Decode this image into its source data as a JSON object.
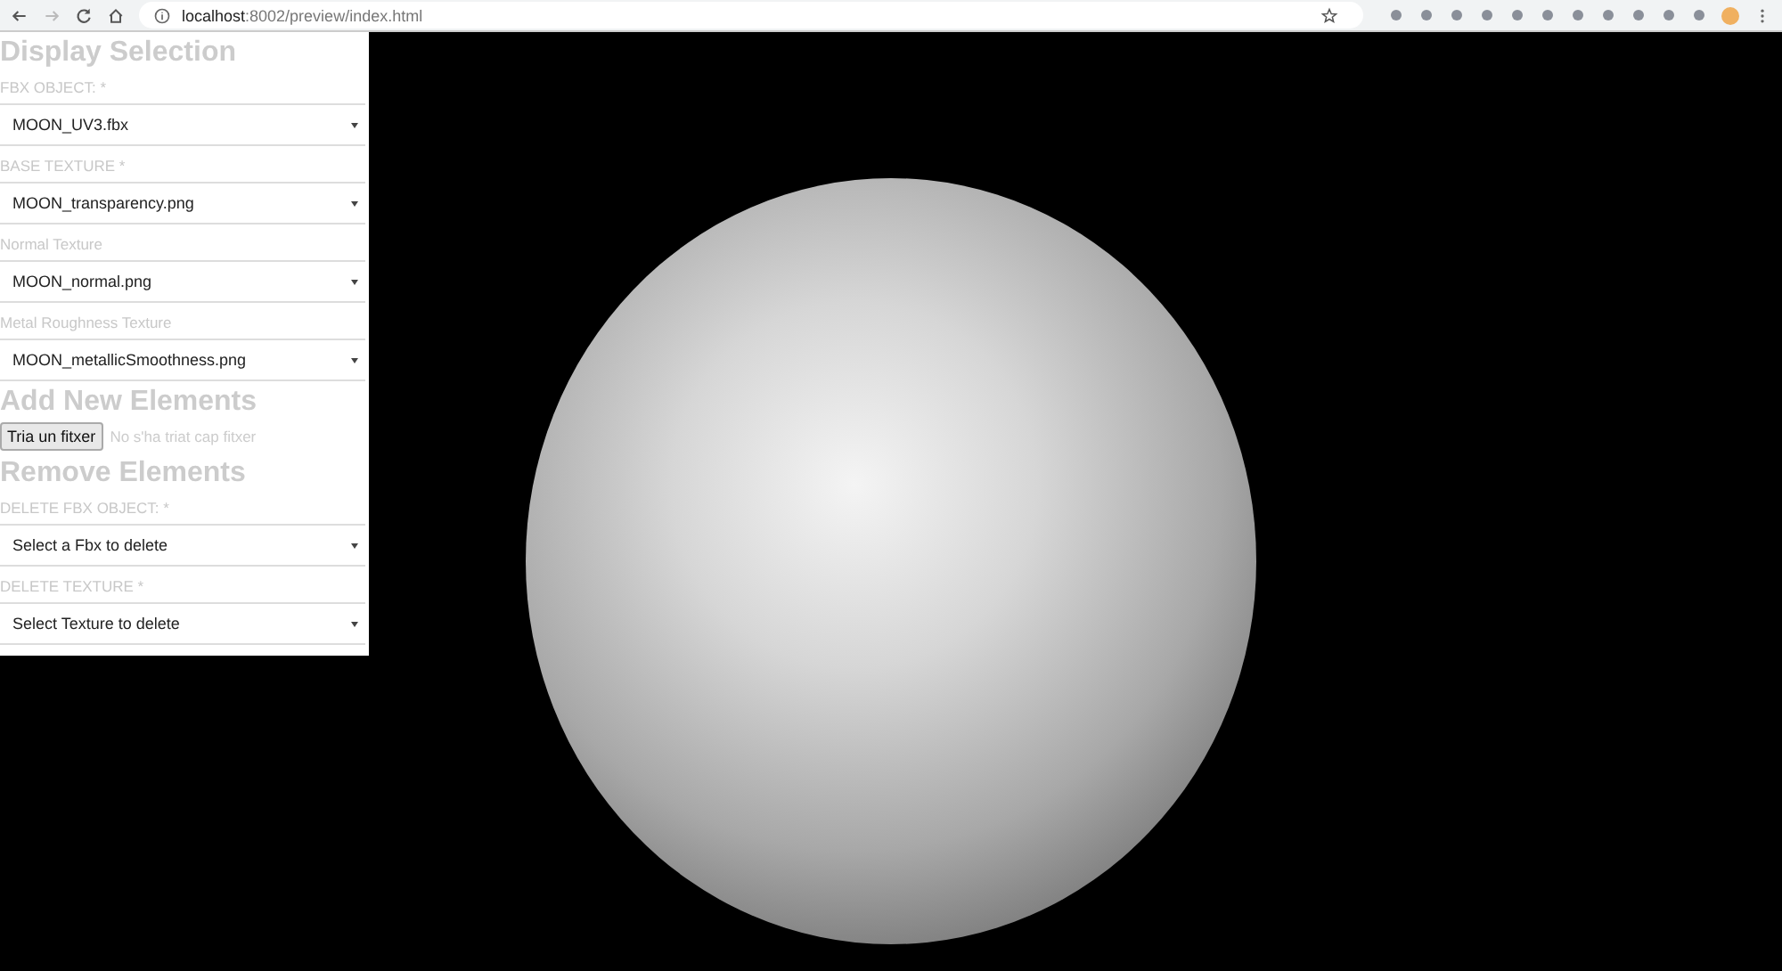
{
  "browser": {
    "url_host": "localhost",
    "url_path": ":8002/preview/index.html"
  },
  "panel": {
    "sections": [
      {
        "title": "Display Selection",
        "fields": [
          {
            "kind": "select",
            "label": "FBX OBJECT: *",
            "value": "MOON_UV3.fbx"
          },
          {
            "kind": "select",
            "label": "BASE TEXTURE *",
            "value": "MOON_transparency.png"
          },
          {
            "kind": "select",
            "label": "Normal Texture",
            "value": "MOON_normal.png"
          },
          {
            "kind": "select",
            "label": "Metal Roughness Texture",
            "value": "MOON_metallicSmoothness.png"
          }
        ]
      },
      {
        "title": "Add New Elements",
        "fields": [
          {
            "kind": "file",
            "button": "Tria un fitxer",
            "status": "No s'ha triat cap fitxer"
          }
        ]
      },
      {
        "title": "Remove Elements",
        "fields": [
          {
            "kind": "select",
            "label": "DELETE FBX OBJECT: *",
            "value": "Select a Fbx to delete"
          },
          {
            "kind": "select",
            "label": "DELETE TEXTURE *",
            "value": "Select Texture to delete"
          }
        ]
      }
    ]
  }
}
